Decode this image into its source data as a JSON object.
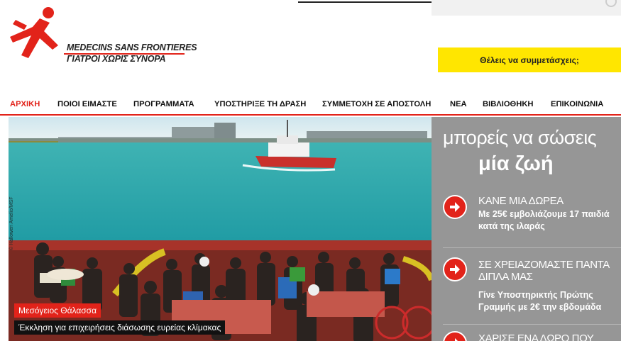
{
  "brand": {
    "name_line1": "MEDECINS SANS FRONTIERES",
    "name_line2": "ΓΙΑΤΡΟΙ ΧΩΡΙΣ ΣΥΝΟΡΑ",
    "accent_color": "#e2231a",
    "cta_color": "#ffe600"
  },
  "header": {
    "cta_label": "Θέλεις να συμμετάσχεις;",
    "search_icon": "search-icon"
  },
  "nav": {
    "items": [
      {
        "label": "ΑΡΧΙΚΗ",
        "active": true
      },
      {
        "label": "ΠΟΙΟΙ ΕΙΜΑΣΤΕ"
      },
      {
        "label": "ΠΡΟΓΡΑΜΜΑΤΑ"
      },
      {
        "label": "ΥΠΟΣΤΗΡΙΞΕ ΤΗ ΔΡΑΣΗ"
      },
      {
        "label": "ΣΥΜΜΕΤΟΧΗ ΣΕ ΑΠΟΣΤΟΛΗ"
      },
      {
        "label": "ΝΕΑ"
      },
      {
        "label": "ΒΙΒΛΙΟΘΗΚΗ"
      },
      {
        "label": "ΕΠΙΚΟΙΝΩΝΙΑ"
      }
    ]
  },
  "hero": {
    "photo_credit": "© Hallowen Amelio/MSF",
    "tag": "Μεσόγειος Θάλασσα",
    "caption": "Έκκληση για επιχειρήσεις διάσωσης ευρείας κλίμακας"
  },
  "side": {
    "heading_line1": "μπορείς να σώσεις",
    "heading_line2": "μία ζωή",
    "items": [
      {
        "title": "ΚΑΝΕ ΜΙΑ ΔΩΡΕΑ",
        "text": "Με 25€ εμβολιάζουμε 17 παιδιά κατά της ιλαράς",
        "icon": "arrow-right-icon"
      },
      {
        "title": "ΣΕ ΧΡΕΙΑΖΟΜΑΣΤΕ ΠΑΝΤΑ ΔΙΠΛΑ ΜΑΣ",
        "text": "Γίνε Υποστηρικτής Πρώτης Γραμμής με 2€ την εβδομάδα",
        "icon": "arrow-right-icon"
      },
      {
        "title": "ΧΑΡΙΣΕ ΕΝΑ ΔΩΡΟ ΠΟΥ",
        "text": "",
        "icon": "arrow-right-icon"
      }
    ]
  }
}
